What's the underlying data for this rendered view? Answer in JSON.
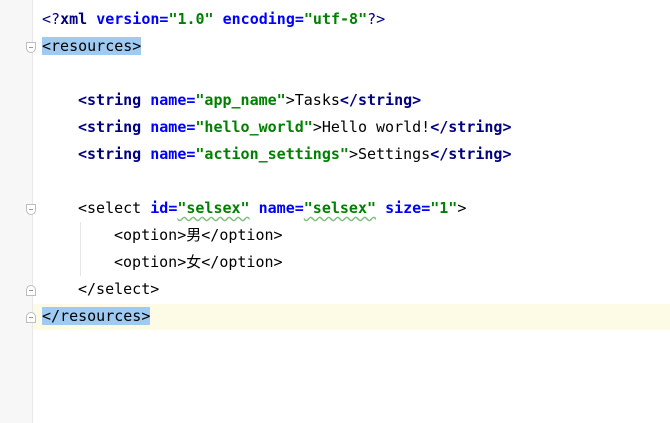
{
  "xml_decl": {
    "open": "<?",
    "name": "xml",
    "version_attr": "version",
    "version_value": "\"1.0\"",
    "encoding_attr": "encoding",
    "encoding_value": "\"utf-8\"",
    "close": "?>"
  },
  "root": {
    "open": "<resources>",
    "close": "</resources>"
  },
  "strings": [
    {
      "attr": "name",
      "value": "\"app_name\"",
      "text": "Tasks"
    },
    {
      "attr": "name",
      "value": "\"hello_world\"",
      "text": "Hello world!"
    },
    {
      "attr": "name",
      "value": "\"action_settings\"",
      "text": "Settings"
    }
  ],
  "tags": {
    "string_open": "<string",
    "string_close": "</string>",
    "select_open": "<select",
    "select_close": "</select>",
    "option_open": "<option>",
    "option_close": "</option>",
    "gt": ">",
    "eq": "="
  },
  "select": {
    "id_attr": "id",
    "id_value": "\"selsex\"",
    "name_attr": "name",
    "name_value": "\"selsex\"",
    "size_attr": "size",
    "size_value": "\"1\""
  },
  "options": [
    "男",
    "女"
  ],
  "colors": {
    "tag": "#000080",
    "attribute": "#0000ff",
    "value": "#008000",
    "highlight": "#9fcbf2",
    "current_line": "#fdfae6"
  }
}
